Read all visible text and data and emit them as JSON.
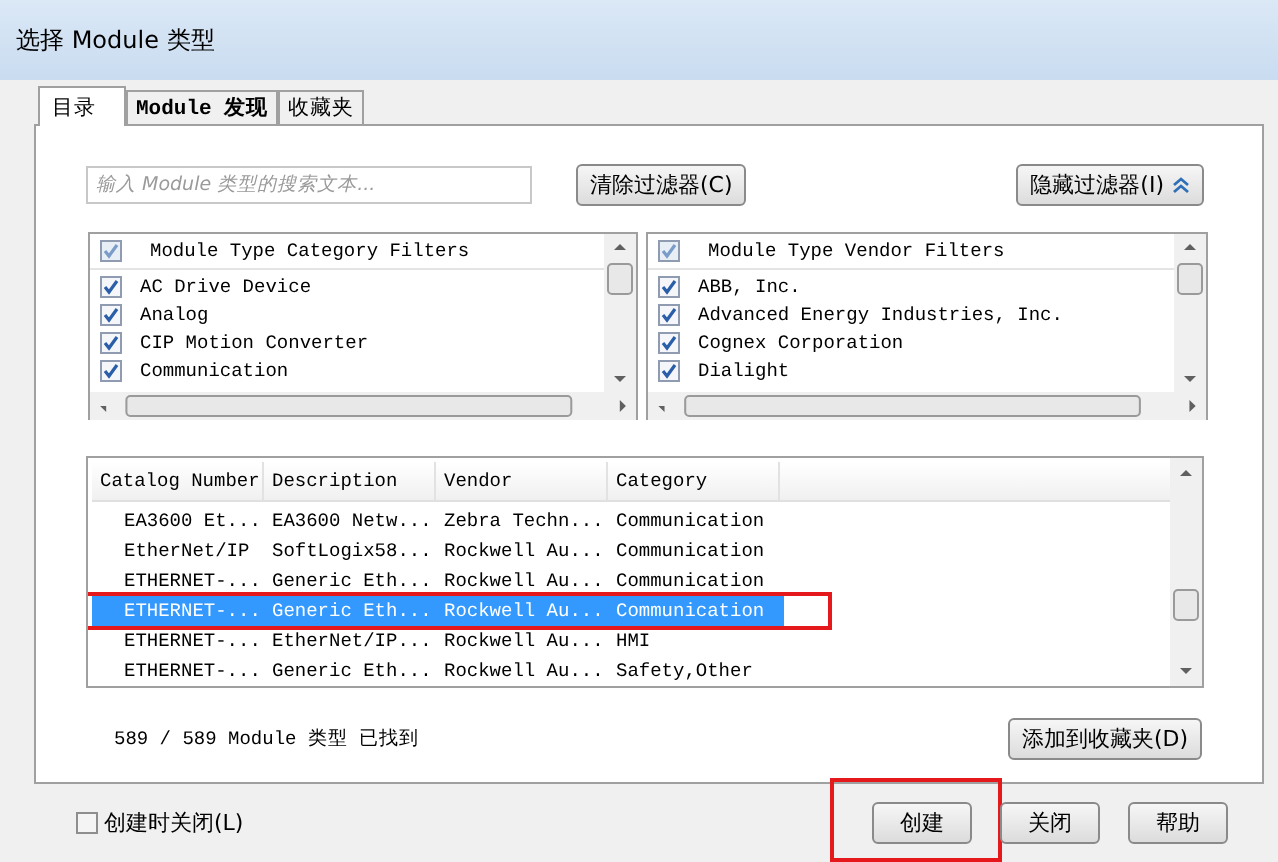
{
  "window": {
    "title": "选择 Module 类型"
  },
  "tabs": [
    {
      "label": "目录",
      "selected": true
    },
    {
      "label": "Module 发现",
      "selected": false
    },
    {
      "label": "收藏夹",
      "selected": false
    }
  ],
  "search": {
    "placeholder": "输入 Module 类型的搜索文本..."
  },
  "clear_filters_button": "清除过滤器(C)",
  "hide_filters_button": "隐藏过滤器(I)",
  "filters": [
    {
      "title": "Module Type Category Filters",
      "all_checked": true,
      "items": [
        {
          "label": "AC Drive Device",
          "checked": true
        },
        {
          "label": "Analog",
          "checked": true
        },
        {
          "label": "CIP Motion Converter",
          "checked": true
        },
        {
          "label": "Communication",
          "checked": true
        }
      ]
    },
    {
      "title": "Module Type Vendor Filters",
      "all_checked": true,
      "items": [
        {
          "label": "ABB, Inc.",
          "checked": true
        },
        {
          "label": "Advanced Energy Industries, Inc.",
          "checked": true
        },
        {
          "label": "Cognex Corporation",
          "checked": true
        },
        {
          "label": "Dialight",
          "checked": true
        }
      ]
    }
  ],
  "table": {
    "columns": [
      "Catalog Number",
      "Description",
      "Vendor",
      "Category"
    ],
    "rows": [
      {
        "cells": [
          "EA3600 Et...",
          "EA3600 Netw...",
          "Zebra Techn...",
          "Communication"
        ],
        "selected": false,
        "outlined": false
      },
      {
        "cells": [
          "EtherNet/IP",
          "SoftLogix58...",
          "Rockwell Au...",
          "Communication"
        ],
        "selected": false,
        "outlined": false
      },
      {
        "cells": [
          "ETHERNET-...",
          "Generic Eth...",
          "Rockwell Au...",
          "Communication"
        ],
        "selected": false,
        "outlined": false
      },
      {
        "cells": [
          "ETHERNET-...",
          "Generic Eth...",
          "Rockwell Au...",
          "Communication"
        ],
        "selected": true,
        "outlined": true
      },
      {
        "cells": [
          "ETHERNET-...",
          "EtherNet/IP...",
          "Rockwell Au...",
          "HMI"
        ],
        "selected": false,
        "outlined": false
      },
      {
        "cells": [
          "ETHERNET-...",
          "Generic Eth...",
          "Rockwell Au...",
          "Safety,Other"
        ],
        "selected": false,
        "outlined": false
      }
    ]
  },
  "status": "589 / 589 Module 类型 已找到",
  "add_favorites_button": "添加到收藏夹(D)",
  "close_on_create": {
    "label": "创建时关闭(L)",
    "checked": false
  },
  "buttons": [
    {
      "label": "创建",
      "outlined": true
    },
    {
      "label": "关闭",
      "outlined": false
    },
    {
      "label": "帮助",
      "outlined": false
    }
  ]
}
